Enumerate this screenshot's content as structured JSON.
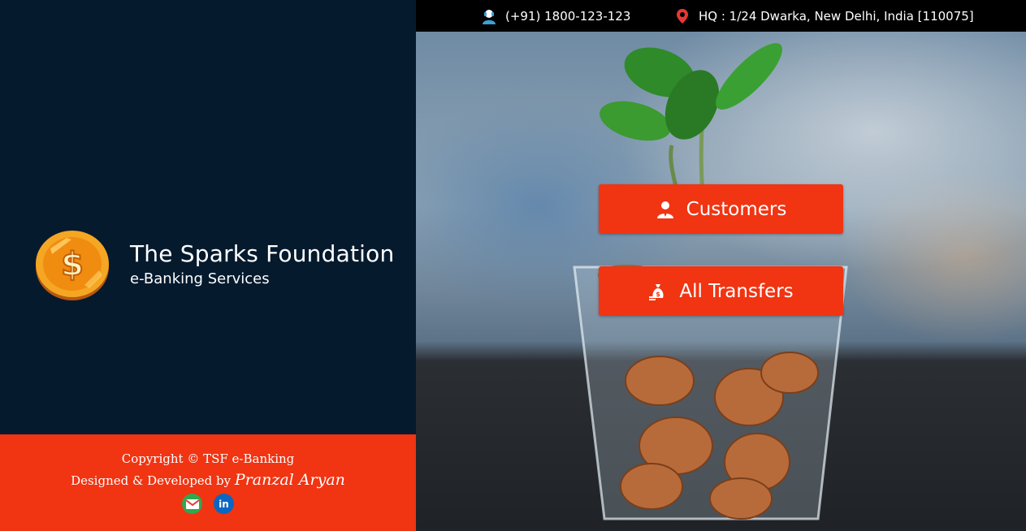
{
  "topbar": {
    "phone": "(+91) 1800-123-123",
    "address": "HQ : 1/24 Dwarka, New Delhi, India [110075]",
    "icons": [
      "user-support-icon",
      "location-pin-icon"
    ]
  },
  "brand": {
    "title": "The Sparks Foundation",
    "subtitle": "e-Banking Services",
    "logo": "dollar-coin-icon"
  },
  "actions": {
    "customers_label": "Customers",
    "transfers_label": "All Transfers"
  },
  "footer": {
    "copyright": "Copyright © TSF e-Banking",
    "designed_by": "Designed & Developed by",
    "developer": "Pranzal Aryan",
    "socials": [
      "gmail-icon",
      "linkedin-icon"
    ]
  },
  "colors": {
    "sidebar_bg": "#061a2e",
    "accent": "#f13412",
    "topbar_bg": "#000000"
  }
}
